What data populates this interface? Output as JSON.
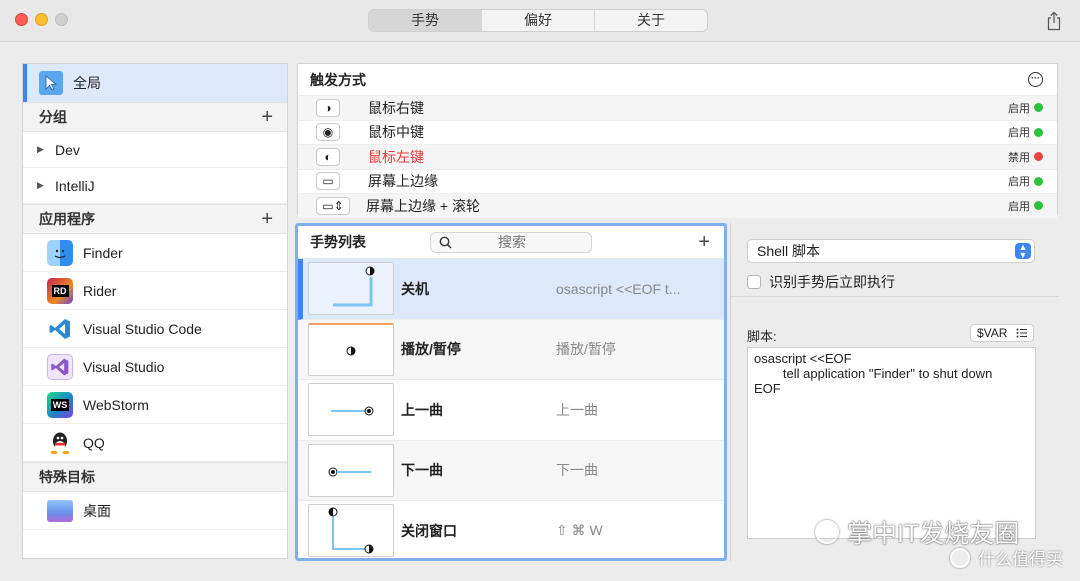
{
  "tabs": [
    {
      "label": "手势",
      "active": true
    },
    {
      "label": "偏好",
      "active": false
    },
    {
      "label": "关于",
      "active": false
    }
  ],
  "sidebar": {
    "global_label": "全局",
    "groups_header": "分组",
    "groups": [
      "Dev",
      "IntelliJ"
    ],
    "apps_header": "应用程序",
    "apps": [
      {
        "name": "Finder",
        "icon": "finder-icon",
        "color": "#2f8ef0"
      },
      {
        "name": "Rider",
        "icon": "rider-icon",
        "color": "#c3224d"
      },
      {
        "name": "Visual Studio Code",
        "icon": "vscode-icon",
        "color": "#2a8ad6"
      },
      {
        "name": "Visual Studio",
        "icon": "visual-studio-icon",
        "color": "#8a57c9"
      },
      {
        "name": "WebStorm",
        "icon": "webstorm-icon",
        "color": "#1c86c7"
      },
      {
        "name": "QQ",
        "icon": "qq-icon",
        "color": "#222222"
      }
    ],
    "special_header": "特殊目标",
    "special": [
      {
        "name": "桌面",
        "icon": "desktop-icon",
        "color": "#6a8fe8"
      }
    ]
  },
  "trigger": {
    "title": "触发方式",
    "rows": [
      {
        "label": "鼠标右键",
        "icon": "◑",
        "status": "启用",
        "color": "#2ec13c",
        "label_color": "#222222"
      },
      {
        "label": "鼠标中键",
        "icon": "◉",
        "status": "启用",
        "color": "#2ec13c",
        "label_color": "#222222"
      },
      {
        "label": "鼠标左键",
        "icon": "◐",
        "status": "禁用",
        "color": "#e8453c",
        "label_color": "#e23a3a"
      },
      {
        "label": "屏幕上边缘",
        "icon": "▭",
        "status": "启用",
        "color": "#2ec13c",
        "label_color": "#222222"
      },
      {
        "label": "屏幕上边缘 + 滚轮",
        "icon": "▭⇕",
        "status": "启用",
        "color": "#2ec13c",
        "label_color": "#222222"
      }
    ]
  },
  "gesture_list": {
    "title": "手势列表",
    "search_placeholder": "搜索",
    "items": [
      {
        "name": "关机",
        "command": "osascript <<EOF    t..."
      },
      {
        "name": "播放/暂停",
        "command": "播放/暂停"
      },
      {
        "name": "上一曲",
        "command": "上一曲"
      },
      {
        "name": "下一曲",
        "command": "下一曲"
      },
      {
        "name": "关闭窗口",
        "command": "⇧ ⌘ W"
      }
    ]
  },
  "script_panel": {
    "type_value": "Shell 脚本",
    "execute_checkbox_label": "识别手势后立即执行",
    "execute_checked": false,
    "script_label": "脚本:",
    "var_button": "$VAR",
    "script_text": "osascript <<EOF\n        tell application \"Finder\" to shut down\nEOF"
  },
  "watermark": {
    "line1": "掌中IT发烧友圈",
    "line2": "什么值得买"
  },
  "colors": {
    "accent": "#3b86f3",
    "selected_bg": "#dbe9fb",
    "enabled": "#2ec13c",
    "disabled": "#e8453c"
  }
}
